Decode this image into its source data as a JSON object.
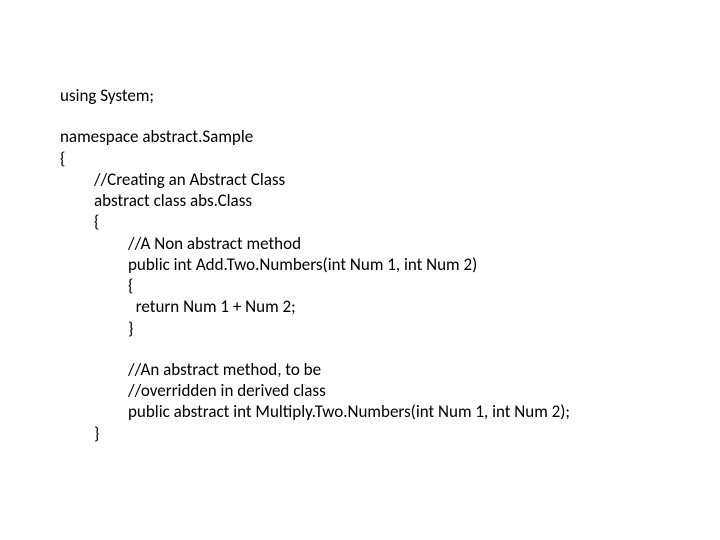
{
  "code": {
    "l1": "using System;",
    "l2": "namespace abstract.Sample",
    "l3": "{",
    "l4": "//Creating an Abstract Class",
    "l5": "abstract class abs.Class",
    "l6": "{",
    "l7": "//A Non abstract method",
    "l8": "public int Add.Two.Numbers(int Num 1, int Num 2)",
    "l9": "{",
    "l10": "  return Num 1 + Num 2;",
    "l11": "}",
    "l12": "//An abstract method, to be",
    "l13": "//overridden in derived class",
    "l14": "public abstract int Multiply.Two.Numbers(int Num 1, int Num 2);",
    "l15": "}"
  }
}
